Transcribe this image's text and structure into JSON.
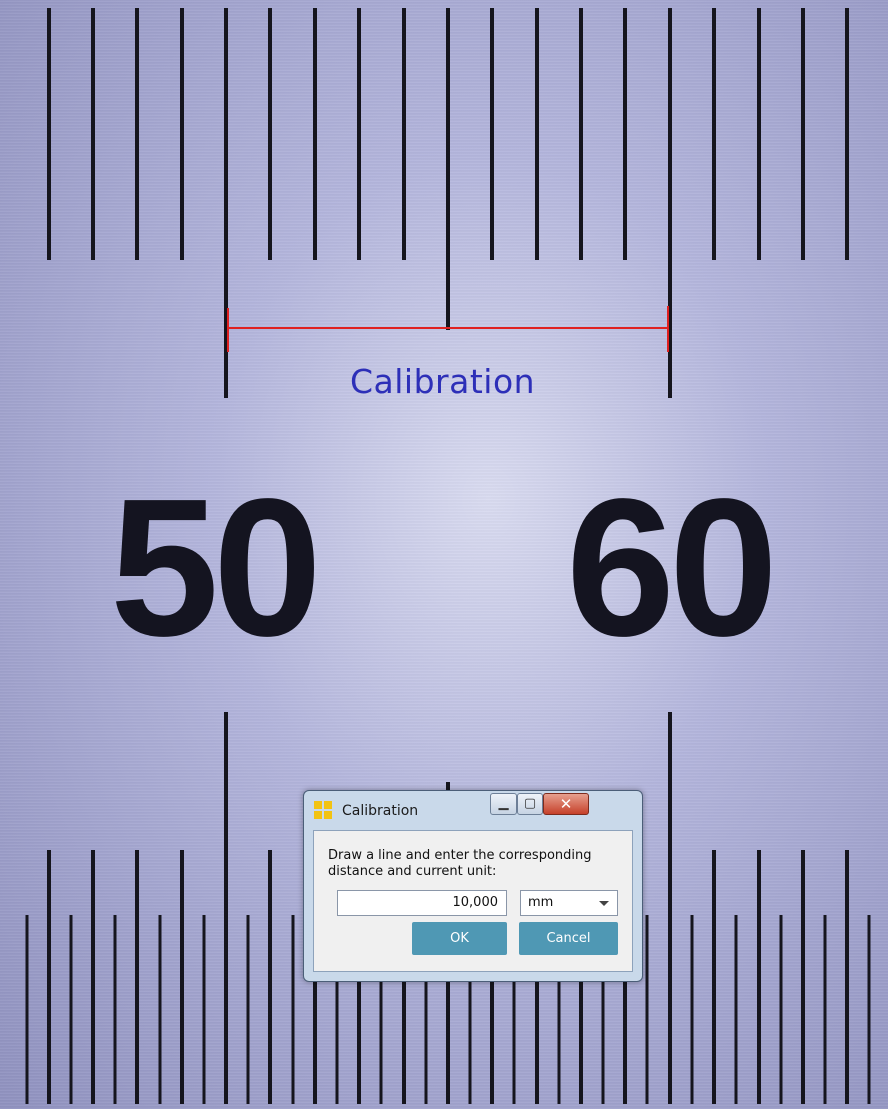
{
  "overlay": {
    "measurement_label": "Calibration",
    "ruler_numbers": [
      "50",
      "60"
    ]
  },
  "dialog": {
    "title": "Calibration",
    "prompt": "Draw a line and enter the corresponding distance and current unit:",
    "distance_value": "10,000",
    "unit": "mm",
    "ok_label": "OK",
    "cancel_label": "Cancel"
  },
  "colors": {
    "calibration_line": "#e02020",
    "calibration_text": "#2d2fb8",
    "button": "#4f98b4"
  }
}
